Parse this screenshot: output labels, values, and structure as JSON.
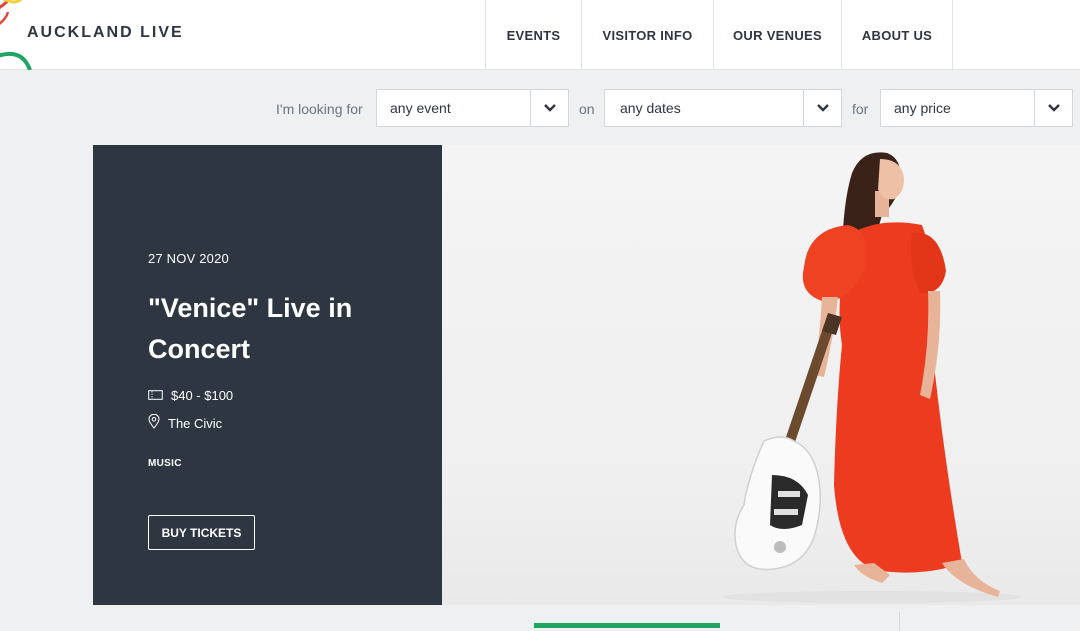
{
  "header": {
    "logo": "AUCKLAND LIVE",
    "nav": [
      "EVENTS",
      "VISITOR INFO",
      "OUR VENUES",
      "ABOUT US"
    ]
  },
  "filters": {
    "looking_for_label": "I'm looking for",
    "event_value": "any event",
    "on_label": "on",
    "dates_value": "any dates",
    "for_label": "for",
    "price_value": "any price"
  },
  "hero": {
    "date": "27 NOV 2020",
    "title": "\"Venice\" Live in Concert",
    "price": "$40 - $100",
    "venue": "The Civic",
    "category": "MUSIC",
    "button": "BUY TICKETS"
  },
  "colors": {
    "panel": "#2e3642",
    "accent_green": "#1fa463",
    "dress": "#ec3b1f"
  },
  "icons": [
    "ticket-icon",
    "location-pin-icon",
    "chevron-down-icon"
  ]
}
